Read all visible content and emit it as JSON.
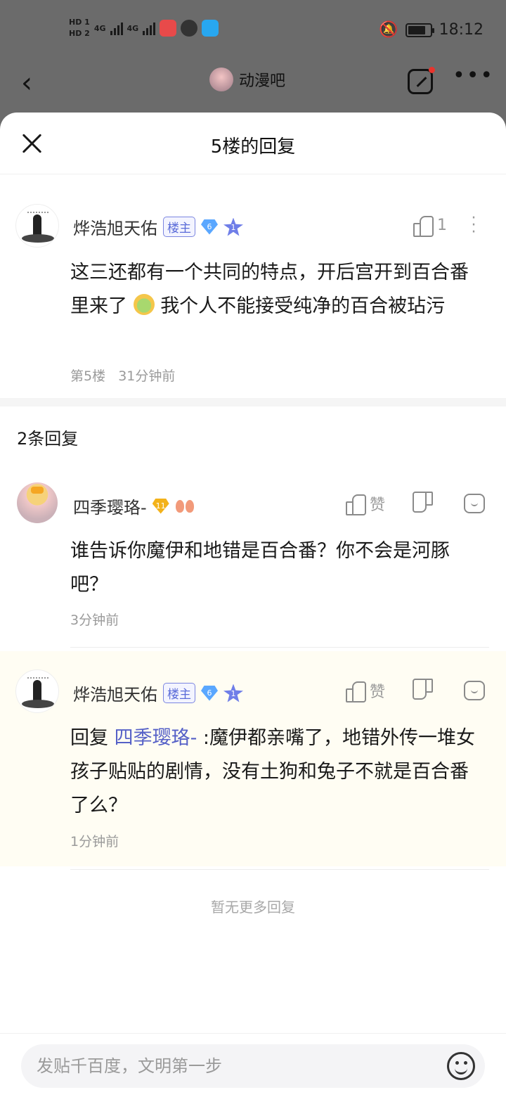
{
  "status_bar": {
    "hd1": "HD 1",
    "hd2": "HD 2",
    "net1": "4G",
    "net2": "4G",
    "time": "18:12",
    "battery_level": 0.8
  },
  "header": {
    "forum_name": "动漫吧"
  },
  "sheet": {
    "title": "5楼的回复",
    "post": {
      "username": "烨浩旭天佑",
      "badge": "楼主",
      "level": "6",
      "star_level": "1",
      "like_count": "1",
      "content_before_emoji": "这三还都有一个共同的特点，开后宫开到百合番里来了",
      "content_after_emoji": "我个人不能接受纯净的百合被玷污",
      "floor": "第5楼",
      "time": "31分钟前"
    },
    "reply_count": "2条回复",
    "replies": [
      {
        "username": "四季璎珞-",
        "level": "11",
        "like_label": "赞",
        "content": "谁告诉你魔伊和地错是百合番？你不会是河豚吧？",
        "time": "3分钟前"
      },
      {
        "username": "烨浩旭天佑",
        "badge": "楼主",
        "level": "6",
        "star_level": "1",
        "like_label": "赞",
        "reply_prefix": "回复 ",
        "mention": "四季璎珞-",
        "content": " :魔伊都亲嘴了，地错外传一堆女孩子贴贴的剧情，没有土狗和兔子不就是百合番了么？",
        "time": "1分钟前"
      }
    ],
    "no_more": "暂无更多回复"
  },
  "composer": {
    "placeholder": "发贴千百度，文明第一步"
  },
  "colors": {
    "accent": "#5560c7",
    "badge_border": "#7b85e0",
    "highlight_bg": "#fffdf3",
    "overlay": "#6b6b6b"
  }
}
